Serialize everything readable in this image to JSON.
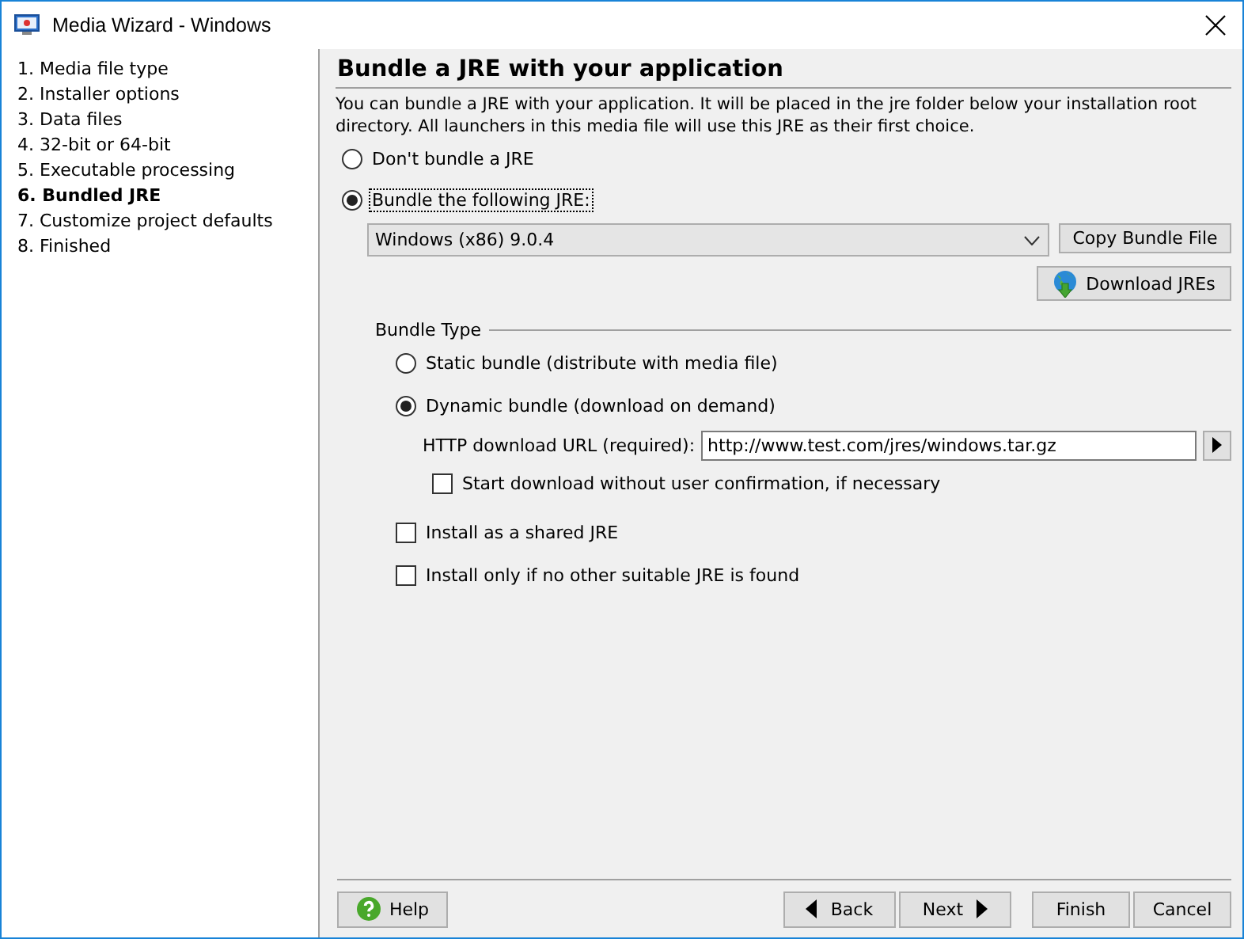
{
  "window": {
    "title": "Media Wizard - Windows"
  },
  "steps": [
    {
      "label": "1. Media file type",
      "selected": false
    },
    {
      "label": "2. Installer options",
      "selected": false
    },
    {
      "label": "3. Data files",
      "selected": false
    },
    {
      "label": "4. 32-bit or 64-bit",
      "selected": false
    },
    {
      "label": "5. Executable processing",
      "selected": false
    },
    {
      "label": "6. Bundled JRE",
      "selected": true
    },
    {
      "label": "7. Customize project defaults",
      "selected": false
    },
    {
      "label": "8. Finished",
      "selected": false
    }
  ],
  "page": {
    "heading": "Bundle a JRE with your application",
    "description": "You can bundle a JRE with your application. It will be placed in the jre folder below your installation root directory. All launchers in this media file will use this JRE as their first choice."
  },
  "bundle_options": [
    {
      "label": "Don't bundle a JRE",
      "selected": false,
      "focused": false
    },
    {
      "label": "Bundle the following JRE:",
      "selected": true,
      "focused": true
    }
  ],
  "jre_select": {
    "value": "Windows (x86) 9.0.4"
  },
  "copy_button": {
    "label": "Copy Bundle File"
  },
  "download_button": {
    "label": "Download JREs"
  },
  "bundle_type": {
    "title": "Bundle Type",
    "options": [
      {
        "label": "Static bundle (distribute with media file)",
        "selected": false
      },
      {
        "label": "Dynamic bundle (download on demand)",
        "selected": true
      }
    ]
  },
  "url": {
    "label": "HTTP download URL (required):",
    "value": "http://www.test.com/jres/windows.tar.gz"
  },
  "start_download": {
    "label": "Start download without user confirmation, if necessary",
    "checked": false
  },
  "install_options": [
    {
      "label": "Install as a shared JRE",
      "checked": false
    },
    {
      "label": "Install only if no other suitable JRE is found",
      "checked": false
    }
  ],
  "buttons": [
    {
      "label": "Help",
      "kind": "help"
    },
    {
      "label": "Back",
      "kind": "back"
    },
    {
      "label": "Next",
      "kind": "next"
    },
    {
      "label": "Finish",
      "kind": "plain"
    },
    {
      "label": "Cancel",
      "kind": "plain"
    }
  ]
}
